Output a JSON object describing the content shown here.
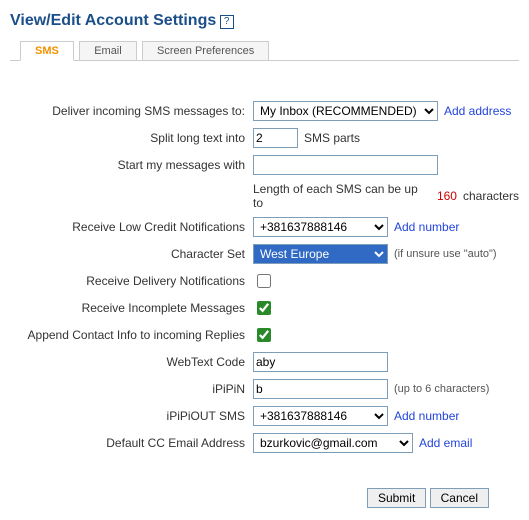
{
  "title": "View/Edit Account Settings",
  "tabs": {
    "sms": "SMS",
    "email": "Email",
    "screen": "Screen Preferences"
  },
  "labels": {
    "deliver": "Deliver incoming SMS messages to:",
    "split": "Split long text into",
    "split_suffix": "SMS parts",
    "startmsg": "Start my messages with",
    "length_a": "Length of each SMS can be up to ",
    "length_n": "160",
    "length_b": " characters",
    "lowcredit": "Receive Low Credit Notifications",
    "charset": "Character Set",
    "charset_hint": "(if unsure use \"auto\")",
    "delivery": "Receive Delivery Notifications",
    "incomplete": "Receive Incomplete Messages",
    "append": "Append Contact Info to incoming Replies",
    "webtext": "WebText Code",
    "ipipin": "iPiPiN",
    "ipipin_hint": "(up to 6 characters)",
    "ipipiout": "iPiPiOUT SMS",
    "ccemail": "Default CC Email Address"
  },
  "values": {
    "deliver": "My Inbox (RECOMMENDED)",
    "split": "2",
    "startmsg": "",
    "lowcredit": "+381637888146",
    "charset": "West Europe",
    "webtext": "aby",
    "ipipin": "b",
    "ipipiout": "+381637888146",
    "ccemail": "bzurkovic@gmail.com"
  },
  "links": {
    "add_address": "Add address",
    "add_number": "Add number",
    "add_email": "Add email"
  },
  "buttons": {
    "submit": "Submit",
    "cancel": "Cancel"
  }
}
